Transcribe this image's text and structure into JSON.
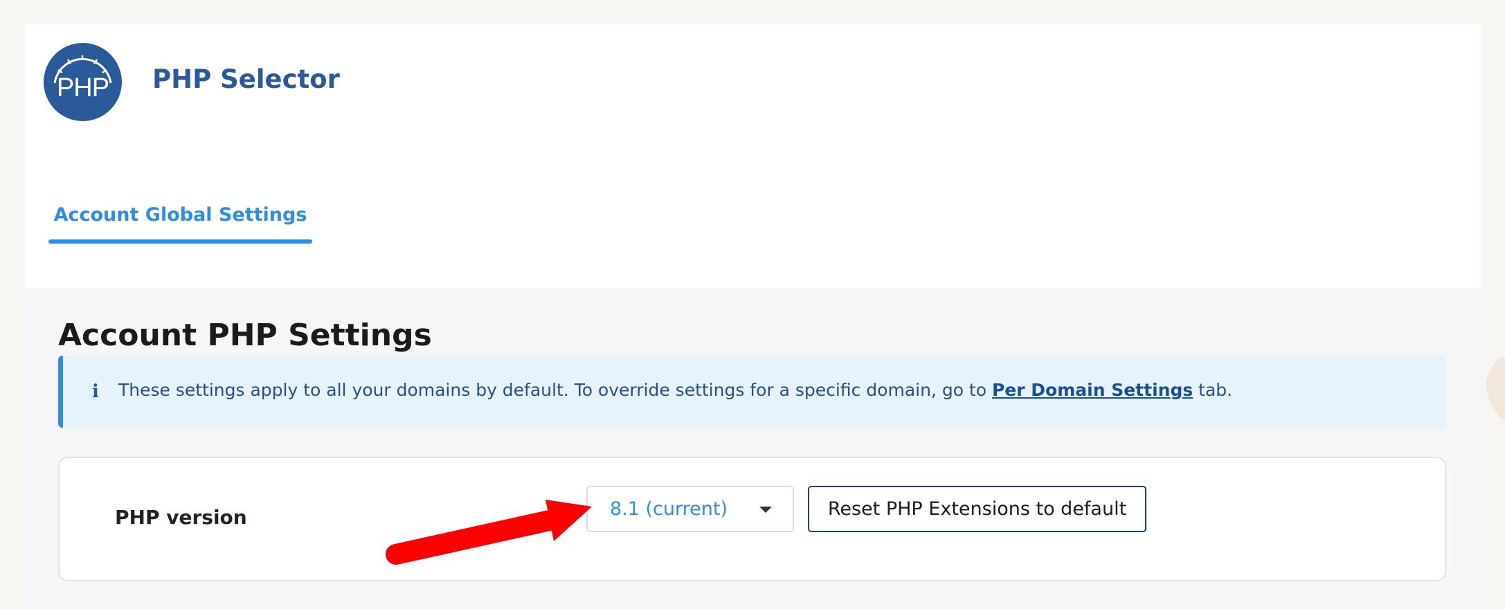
{
  "app": {
    "logo_text": "PHP",
    "title": "PHP Selector"
  },
  "tabs": [
    {
      "label": "Account Global Settings",
      "active": true
    }
  ],
  "section": {
    "heading": "Account PHP Settings"
  },
  "info": {
    "icon": "info-icon",
    "icon_glyph": "i",
    "text_before": "These settings apply to all your domains by default. To override settings for a specific domain, go to ",
    "link_text": "Per Domain Settings",
    "text_after": " tab."
  },
  "php_version": {
    "label": "PHP version",
    "selected": "8.1 (current)",
    "reset_button_label": "Reset PHP Extensions to default"
  },
  "colors": {
    "brand_blue": "#2b5a9b",
    "accent_blue": "#2d8ee3",
    "info_bg": "#e6f3fd",
    "annotation_red": "#ff0000"
  }
}
